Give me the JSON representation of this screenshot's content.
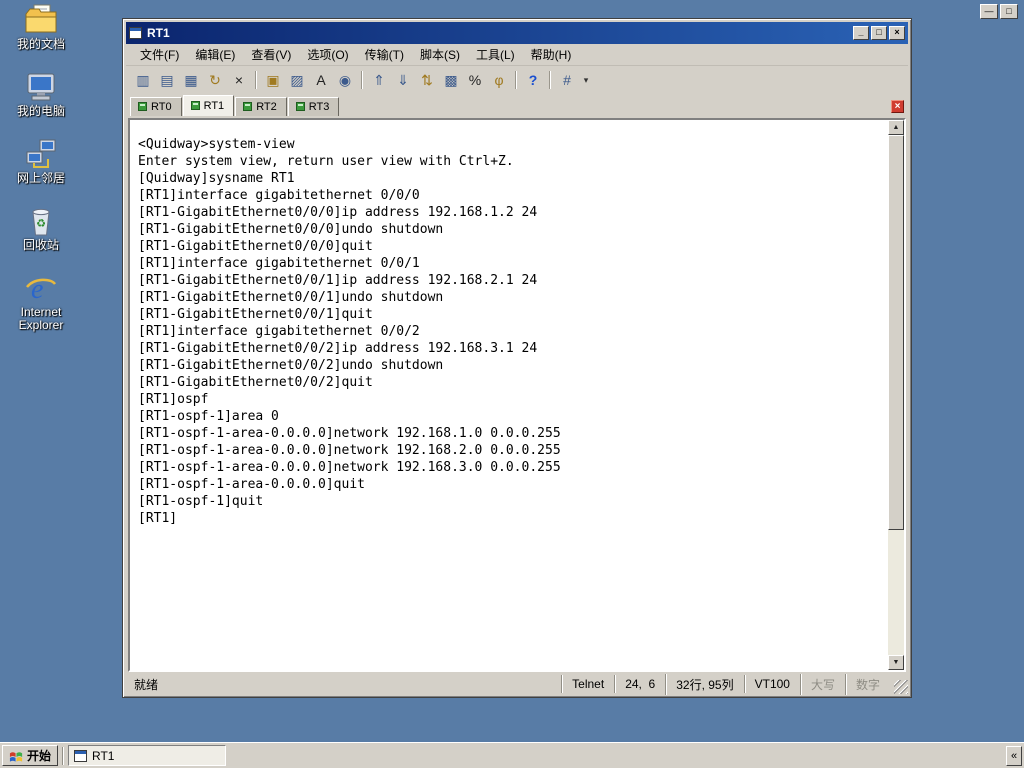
{
  "desktop": {
    "icons": [
      {
        "label": "我的文档"
      },
      {
        "label": "我的电脑"
      },
      {
        "label": "网上邻居"
      },
      {
        "label": "回收站"
      },
      {
        "label": "Internet Explorer"
      }
    ],
    "session_controls": {
      "minimize": "—",
      "restore": "□"
    }
  },
  "window": {
    "title": "RT1",
    "controls": {
      "minimize": "_",
      "maximize": "□",
      "close": "×"
    },
    "menus": [
      "文件(F)",
      "编辑(E)",
      "查看(V)",
      "选项(O)",
      "传输(T)",
      "脚本(S)",
      "工具(L)",
      "帮助(H)"
    ],
    "toolbar": [
      {
        "name": "quick-connect",
        "glyph": "▥"
      },
      {
        "name": "connect",
        "glyph": "▤"
      },
      {
        "name": "clone-tab",
        "glyph": "▦"
      },
      {
        "name": "reconnect",
        "glyph": "↻"
      },
      {
        "name": "disconnect",
        "glyph": "×"
      },
      {
        "name": "copy",
        "glyph": "▣"
      },
      {
        "name": "paste",
        "glyph": "▨"
      },
      {
        "name": "font",
        "glyph": "A"
      },
      {
        "name": "find",
        "glyph": "◉"
      },
      {
        "name": "upload",
        "glyph": "⇑"
      },
      {
        "name": "download",
        "glyph": "⇓"
      },
      {
        "name": "transfer",
        "glyph": "⇅"
      },
      {
        "name": "session-options",
        "glyph": "▩"
      },
      {
        "name": "global-options",
        "glyph": "%"
      },
      {
        "name": "key",
        "glyph": "φ"
      },
      {
        "name": "help",
        "glyph": "?"
      },
      {
        "name": "keymap",
        "glyph": "#"
      },
      {
        "name": "overflow",
        "glyph": "▾"
      }
    ],
    "tabs": [
      {
        "label": "RT0"
      },
      {
        "label": "RT1"
      },
      {
        "label": "RT2"
      },
      {
        "label": "RT3"
      }
    ],
    "tab_close_glyph": "×",
    "scrollbar": {
      "up": "▲",
      "down": "▼"
    },
    "terminal_lines": [
      "<Quidway>system-view",
      "Enter system view, return user view with Ctrl+Z.",
      "[Quidway]sysname RT1",
      "[RT1]interface gigabitethernet 0/0/0",
      "[RT1-GigabitEthernet0/0/0]ip address 192.168.1.2 24",
      "[RT1-GigabitEthernet0/0/0]undo shutdown",
      "[RT1-GigabitEthernet0/0/0]quit",
      "[RT1]interface gigabitethernet 0/0/1",
      "[RT1-GigabitEthernet0/0/1]ip address 192.168.2.1 24",
      "[RT1-GigabitEthernet0/0/1]undo shutdown",
      "[RT1-GigabitEthernet0/0/1]quit",
      "[RT1]interface gigabitethernet 0/0/2",
      "[RT1-GigabitEthernet0/0/2]ip address 192.168.3.1 24",
      "[RT1-GigabitEthernet0/0/2]undo shutdown",
      "[RT1-GigabitEthernet0/0/2]quit",
      "[RT1]ospf",
      "[RT1-ospf-1]area 0",
      "[RT1-ospf-1-area-0.0.0.0]network 192.168.1.0 0.0.0.255",
      "[RT1-ospf-1-area-0.0.0.0]network 192.168.2.0 0.0.0.255",
      "[RT1-ospf-1-area-0.0.0.0]network 192.168.3.0 0.0.0.255",
      "[RT1-ospf-1-area-0.0.0.0]quit",
      "[RT1-ospf-1]quit",
      "[RT1]"
    ],
    "statusbar": {
      "ready": "就绪",
      "protocol": "Telnet",
      "cursor": "24,  6",
      "size": "32行, 95列",
      "emulation": "VT100",
      "caps": "大写",
      "num": "数字"
    }
  },
  "taskbar": {
    "start": "开始",
    "tasks": [
      {
        "label": "RT1"
      }
    ],
    "overflow": "«"
  }
}
